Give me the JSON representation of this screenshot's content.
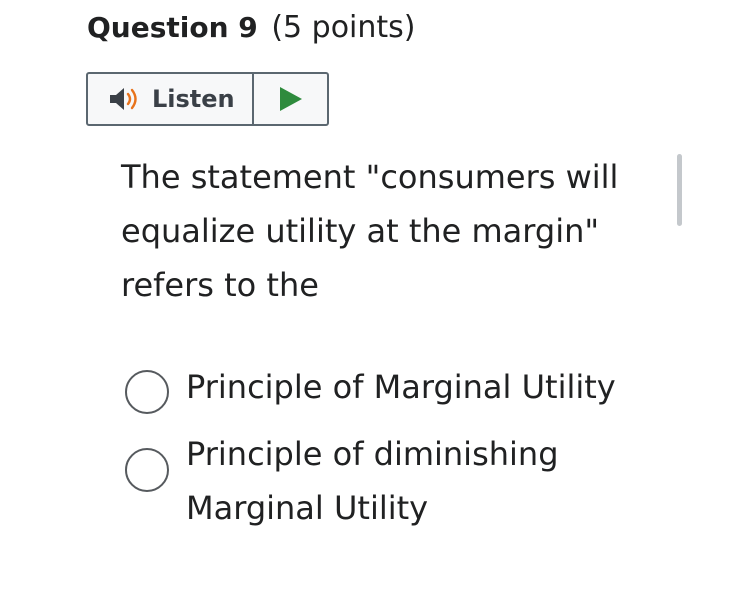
{
  "question": {
    "title": "Question 9",
    "points": "(5 points)"
  },
  "listen": {
    "label": "Listen",
    "speaker_icon": "speaker-icon",
    "play_icon": "play-icon",
    "colors": {
      "speaker": "#3a4047",
      "sound_waves": "#e8731c",
      "play": "#2e8b3d"
    }
  },
  "prompt": {
    "text": "The statement \"consumers will equalize utility at the margin\" refers to the"
  },
  "options": [
    {
      "label": "Principle of Marginal Utility",
      "selected": false
    },
    {
      "label": "Principle of diminishing Marginal Utility",
      "selected": false
    }
  ]
}
